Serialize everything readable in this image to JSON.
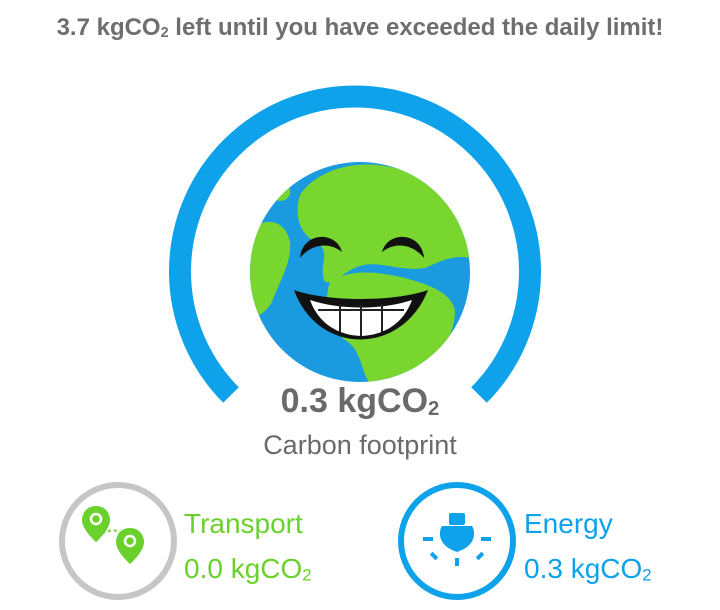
{
  "headline": {
    "prefix": "3.7 kgCO",
    "subscript": "2",
    "suffix": " left until you have exceeded the daily limit!"
  },
  "gauge": {
    "value_number": "0.3 kgCO",
    "value_subscript": "2",
    "label": "Carbon footprint",
    "arc_color": "#0da2ea",
    "mascot": "smiling-earth"
  },
  "categories": [
    {
      "name": "Transport",
      "value_number": "0.0 kgCO",
      "value_subscript": "2",
      "icon": "map-pins-route-icon",
      "color": "#6ad12c",
      "ring_color": "#c6c6c6"
    },
    {
      "name": "Energy",
      "value_number": "0.3 kgCO",
      "value_subscript": "2",
      "icon": "light-bulb-icon",
      "color": "#0da2ea",
      "ring_color": "#0da2ea"
    }
  ]
}
